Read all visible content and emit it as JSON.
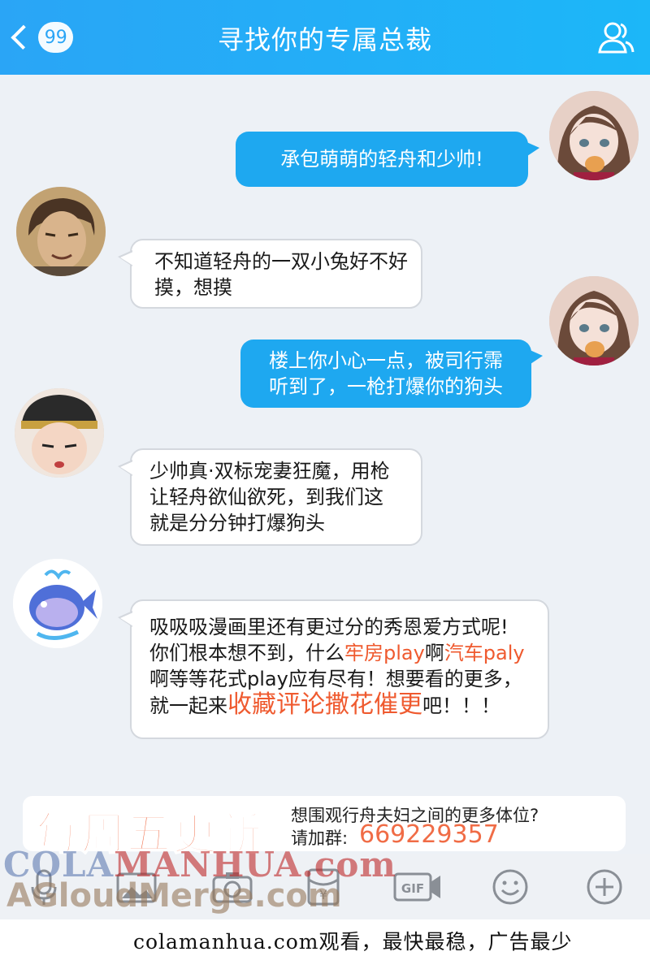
{
  "header": {
    "unread_count": "99",
    "title": "寻找你的专属总裁"
  },
  "messages": [
    {
      "side": "right",
      "text": "承包萌萌的轻舟和少帅!"
    },
    {
      "side": "left",
      "text": "不知道轻舟的一双小兔好不好摸，想摸"
    },
    {
      "side": "right",
      "line1": "楼上你小心一点，被司行霈",
      "line2": "听到了，一枪打爆你的狗头"
    },
    {
      "side": "left",
      "line1": "少帅真·双标宠妻狂魔，用枪",
      "line2": "让轻舟欲仙欲死，到我们这",
      "line3": "就是分分钟打爆狗头"
    },
    {
      "side": "left",
      "line1": "吸吸吸漫画里还有更过分的秀恩爱方式呢!",
      "line2_a": "你们根本想不到，什么",
      "line2_b": "牢房play",
      "line2_c": "啊",
      "line2_d": "汽车paly",
      "line3": "啊等等花式play应有尽有！想要看的更多，",
      "line4_a": "就一起来",
      "line4_b": "收藏评论撒花催更",
      "line4_c": "吧！！！"
    }
  ],
  "banner": {
    "big_text": "每周五更新",
    "line1": "想围观行舟夫妇之间的更多体位?",
    "line2": "请加群:",
    "qq_group": "669229357"
  },
  "toolbar": {
    "gif_label": "GIF"
  },
  "watermarks": {
    "line1_a": "COLA",
    "line1_b": "MANHUA.com",
    "line2": "AGloudMerge.com"
  },
  "footer": {
    "text": "colamanhua.com观看，最快最稳，广告最少"
  },
  "colors": {
    "header": "#2aa5f6",
    "bubble_right": "#1ea8f0",
    "highlight": "#ef5a2f"
  }
}
